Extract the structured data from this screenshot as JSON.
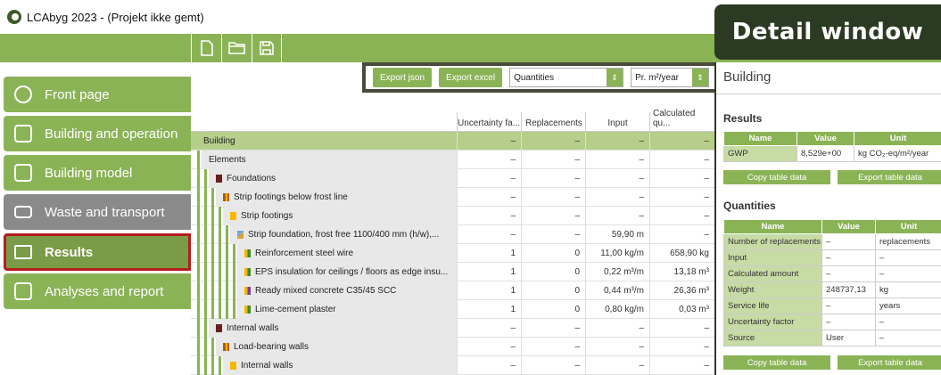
{
  "app": {
    "title": "LCAbyg 2023 - (Projekt ikke gemt)"
  },
  "callout": "Detail window",
  "toolbar": {
    "icons": [
      "new-file-icon",
      "open-folder-icon",
      "save-icon"
    ]
  },
  "sidebar": {
    "items": [
      {
        "label": "Front page",
        "icon": "home-gear-icon"
      },
      {
        "label": "Building and operation",
        "icon": "house-icon"
      },
      {
        "label": "Building model",
        "icon": "building-model-icon"
      },
      {
        "label": "Waste and transport",
        "icon": "truck-icon"
      },
      {
        "label": "Results",
        "icon": "table-icon"
      },
      {
        "label": "Analyses and report",
        "icon": "chart-icon"
      }
    ]
  },
  "filters": {
    "export_json": "Export json",
    "export_excel": "Export excel",
    "view_select": "Quantities",
    "unit_select": "Pr. m²/year"
  },
  "grid": {
    "headers": [
      "Uncertainty fa...",
      "Replacements",
      "Input",
      "Calculated qu..."
    ],
    "rows": [
      {
        "name": "Building",
        "u": "–",
        "r": "–",
        "i": "–",
        "c": "–"
      },
      {
        "name": "Elements",
        "u": "–",
        "r": "–",
        "i": "–",
        "c": "–"
      },
      {
        "name": "Foundations",
        "u": "–",
        "r": "–",
        "i": "–",
        "c": "–"
      },
      {
        "name": "Strip footings below frost line",
        "u": "–",
        "r": "–",
        "i": "–",
        "c": "–"
      },
      {
        "name": "Strip footings",
        "u": "–",
        "r": "–",
        "i": "–",
        "c": "–"
      },
      {
        "name": "Strip foundation, frost free 1100/400 mm (h/w),...",
        "u": "–",
        "r": "–",
        "i": "59,90 m",
        "c": "–"
      },
      {
        "name": "Reinforcement steel wire",
        "u": "1",
        "r": "0",
        "i": "11,00 kg/m",
        "c": "658,90 kg"
      },
      {
        "name": "EPS insulation for ceilings / floors as edge insu...",
        "u": "1",
        "r": "0",
        "i": "0,22 m³/m",
        "c": "13,18 m³"
      },
      {
        "name": "Ready mixed concrete C35/45 SCC",
        "u": "1",
        "r": "0",
        "i": "0,44 m³/m",
        "c": "26,36 m³"
      },
      {
        "name": "Lime-cement plaster",
        "u": "1",
        "r": "0",
        "i": "0,80 kg/m",
        "c": "0,03 m³"
      },
      {
        "name": "Internal walls",
        "u": "–",
        "r": "–",
        "i": "–",
        "c": "–"
      },
      {
        "name": "Load-bearing walls",
        "u": "–",
        "r": "–",
        "i": "–",
        "c": "–"
      },
      {
        "name": "Internal walls",
        "u": "–",
        "r": "–",
        "i": "–",
        "c": "–"
      }
    ]
  },
  "panel": {
    "title": "Building",
    "results": {
      "title": "Results",
      "headers": [
        "Name",
        "Value",
        "Unit"
      ],
      "rows": [
        {
          "name": "GWP",
          "value": "8,529e+00",
          "unit": "kg CO₂-eq/m²/year"
        }
      ],
      "copy": "Copy table data",
      "export": "Export table data"
    },
    "quantities": {
      "title": "Quantities",
      "headers": [
        "Name",
        "Value",
        "Unit"
      ],
      "rows": [
        {
          "name": "Number of replacements",
          "value": "–",
          "unit": "replacements"
        },
        {
          "name": "Input",
          "value": "–",
          "unit": "–"
        },
        {
          "name": "Calculated amount",
          "value": "–",
          "unit": "–"
        },
        {
          "name": "Weight",
          "value": "248737,13",
          "unit": "kg"
        },
        {
          "name": "Service life",
          "value": "–",
          "unit": "years"
        },
        {
          "name": "Uncertainty factor",
          "value": "–",
          "unit": "–"
        },
        {
          "name": "Source",
          "value": "User",
          "unit": "–"
        }
      ],
      "copy": "Copy table data",
      "export": "Export table data"
    }
  }
}
